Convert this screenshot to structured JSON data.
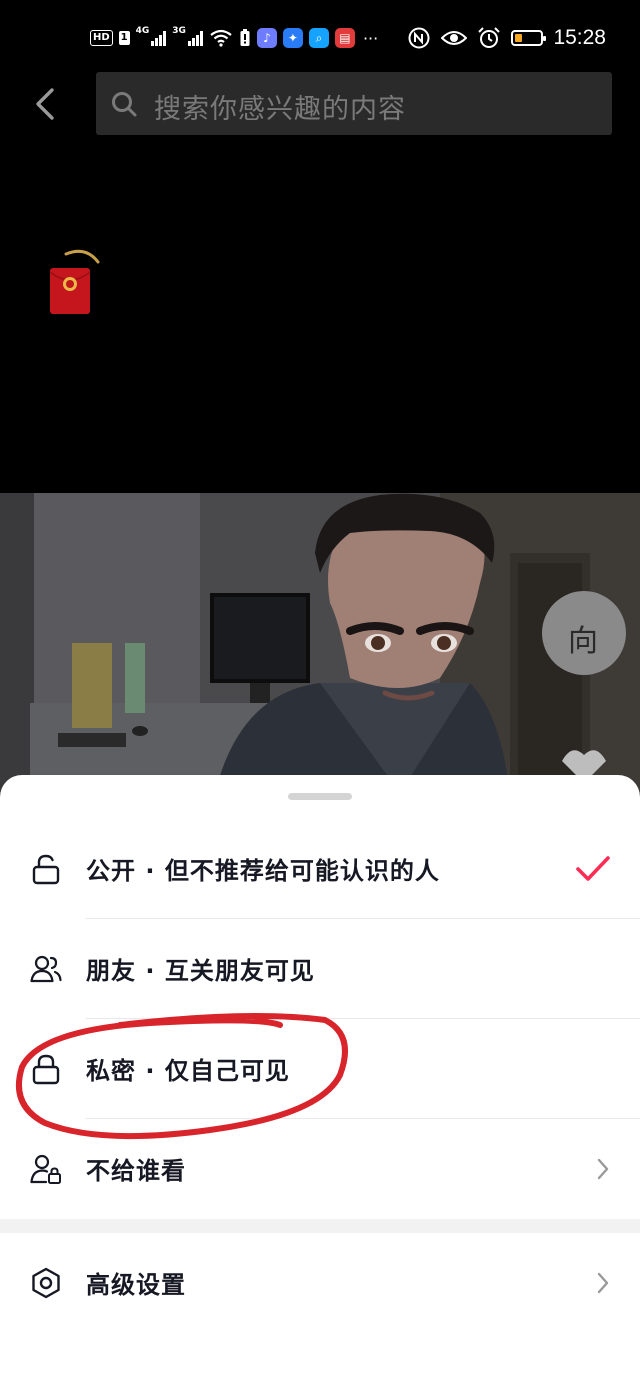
{
  "status_bar": {
    "hd_label": "HD",
    "sim1_label": "1",
    "net1_label": "4G",
    "net2_label": "3G",
    "more_label": "···",
    "time": "15:28",
    "battery_level": 0.3,
    "battery_color": "#f5a623"
  },
  "search": {
    "placeholder": "搜索你感兴趣的内容"
  },
  "visibility_sheet": {
    "options": [
      {
        "label": "公开 · 但不推荐给可能认识的人",
        "icon": "unlock-icon",
        "selected": true
      },
      {
        "label": "朋友 · 互关朋友可见",
        "icon": "friends-icon",
        "selected": false
      },
      {
        "label": "私密 · 仅自己可见",
        "icon": "lock-icon",
        "selected": false
      },
      {
        "label": "不给谁看",
        "icon": "user-lock-icon",
        "selected": false,
        "has_arrow": true
      }
    ],
    "advanced": {
      "label": "高级设置",
      "icon": "hexagon-settings-icon",
      "has_arrow": true
    }
  },
  "colors": {
    "accent": "#fe2c55",
    "text": "#161823",
    "annotation": "#d8242b"
  }
}
